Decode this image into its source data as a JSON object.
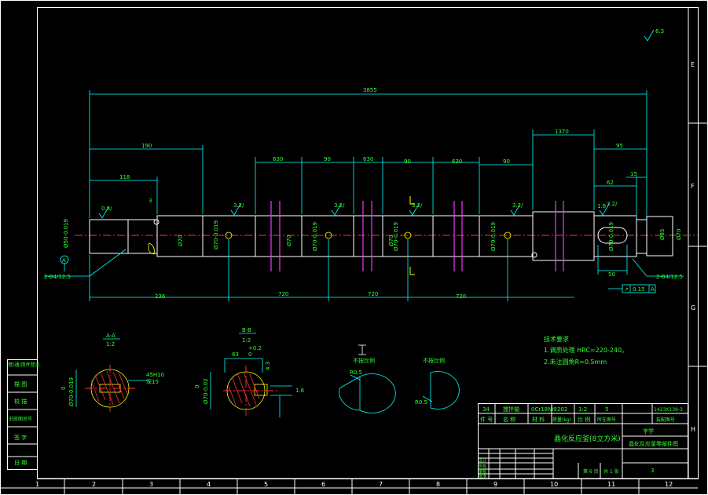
{
  "dimensions": {
    "overall": "3855",
    "d190": "190",
    "d118": "118",
    "d1370": "1370",
    "d95": "95",
    "d630a": "630",
    "d90a": "90",
    "d630b": "630",
    "d90b": "90",
    "d630c": "630",
    "d90c": "90",
    "d62": "62",
    "d15": "15",
    "d236": "236",
    "d720a": "720",
    "d720b": "720",
    "d720c": "720",
    "d3": "3",
    "d50": "50",
    "d18": "1.8",
    "d85": "Ø85",
    "d70r": "Ø70"
  },
  "roughness": {
    "r08": "0.8/",
    "r32a": "3.2/",
    "r32b": "3.2/",
    "r32c": "3.2/",
    "r32d": "3.2/",
    "r32e": "3.2/",
    "top": "6.3"
  },
  "dia_labels": {
    "end_left": "Ø50-0.019",
    "d1": "Ø70",
    "d2": "Ø70-0.019",
    "d3": "Ø70",
    "d4": "Ø70-0.019",
    "d5": "Ø70",
    "d6": "Ø70-0.019",
    "d7": "Ø70-0.019",
    "d8": "Ø70-0.019"
  },
  "callouts": {
    "left_hole": "2-B4/12.5",
    "right_hole": "2-B4/12.5",
    "runout_sym": "↗",
    "runout_val": "0.15",
    "runout_ref": "A",
    "datum_left": "A"
  },
  "sections": {
    "aa_title": "A-A",
    "aa_scale": "1:2",
    "aa_dim": "Ø70-0.019",
    "aa_key": "45H10",
    "aa_key2": "深15",
    "aa_zero": "0",
    "bb_title": "B-B",
    "bb_scale": "1:2",
    "bb_dim": "Ø70-0.02",
    "bb_width": "63",
    "bb_tol": "+0.2",
    "bb_tol2": "0",
    "bb_side": "4.3",
    "bb_depth": "1.6",
    "bb_zero": "0",
    "det1_label": "不按比例",
    "det1_r": "R0.5",
    "det2_label": "不按比例",
    "det2_r": "R0.5",
    "det1_mark": "I"
  },
  "tech_notes": {
    "title": "技术要求",
    "line1": "1.调质处理 HRC=220-240。",
    "line2": "2.未注圆角R=0.5mm"
  },
  "title_block": {
    "r1c1": "34",
    "r1c2": "搅拌轴",
    "r1c3": "0Cr18Ni9",
    "r1c4": "202",
    "r1c5": "1:2",
    "r1c6": "5",
    "r1c7": "1423X139-3",
    "h1": "件 号",
    "h2": "名  称",
    "h3": "材 料",
    "h4": "质量(kg)",
    "h5": "比 例",
    "h6": "所在图号",
    "h7": "装配图号",
    "main_title": "晶化反应釜(8立方米)",
    "school": "字学",
    "drawing_name": "晶化反应釜零部件图",
    "sheet": "3",
    "design": "设计",
    "check": "校核",
    "review": "审核",
    "approve": "批准",
    "sheet_label": "张",
    "sheet_total": "第 1 张",
    "footer1": "第 6 页",
    "footer2": "共 1 张"
  },
  "left_block": {
    "b1": "借(通)用件登记",
    "b2": "描 图",
    "b3": "校 描",
    "b4": "旧底图总号",
    "b5": "签 字",
    "b6": "日 期"
  },
  "zones": {
    "bottom": [
      "1",
      "2",
      "3",
      "4",
      "5",
      "6",
      "7",
      "8",
      "9",
      "10",
      "11",
      "12"
    ],
    "right": [
      "E",
      "F",
      "G",
      "H"
    ]
  }
}
